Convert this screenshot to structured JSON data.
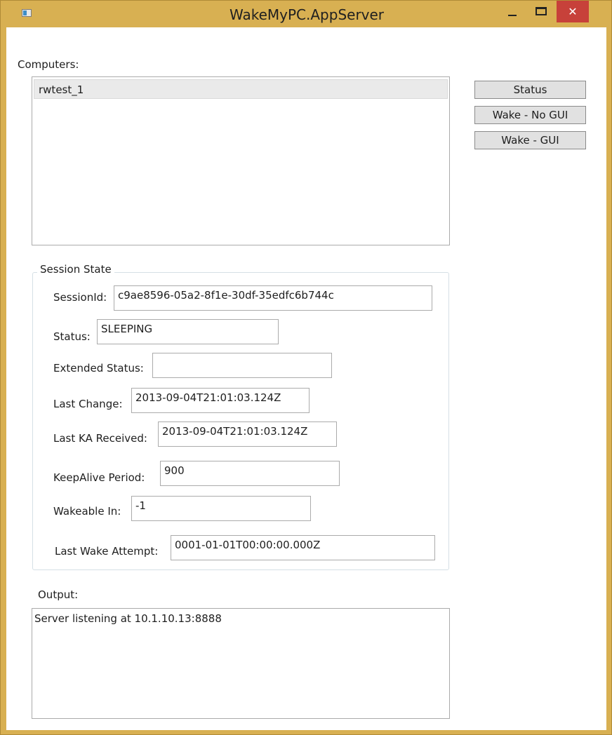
{
  "window": {
    "title": "WakeMyPC.AppServer",
    "minimize_icon": "minimize-icon",
    "maximize_icon": "maximize-icon",
    "close_glyph": "✕",
    "close_color": "#c7413a",
    "frame_color": "#d8b052"
  },
  "computers": {
    "label": "Computers:",
    "items": [
      "rwtest_1"
    ]
  },
  "buttons": {
    "status": "Status",
    "wake_no_gui": "Wake - No GUI",
    "wake_gui": "Wake - GUI"
  },
  "session_state": {
    "title": "Session State",
    "session_id": {
      "label": "SessionId:",
      "value": "c9ae8596-05a2-8f1e-30df-35edfc6b744c"
    },
    "status": {
      "label": "Status:",
      "value": "SLEEPING"
    },
    "extended_status": {
      "label": "Extended Status:",
      "value": ""
    },
    "last_change": {
      "label": "Last Change:",
      "value": "2013-09-04T21:01:03.124Z"
    },
    "last_ka_received": {
      "label": "Last KA Received:",
      "value": "2013-09-04T21:01:03.124Z"
    },
    "keepalive_period": {
      "label": "KeepAlive Period:",
      "value": "900"
    },
    "wakeable_in": {
      "label": "Wakeable In:",
      "value": "-1"
    },
    "last_wake_attempt": {
      "label": "Last Wake Attempt:",
      "value": "0001-01-01T00:00:00.000Z"
    }
  },
  "output": {
    "label": "Output:",
    "text": "Server listening at 10.1.10.13:8888"
  }
}
